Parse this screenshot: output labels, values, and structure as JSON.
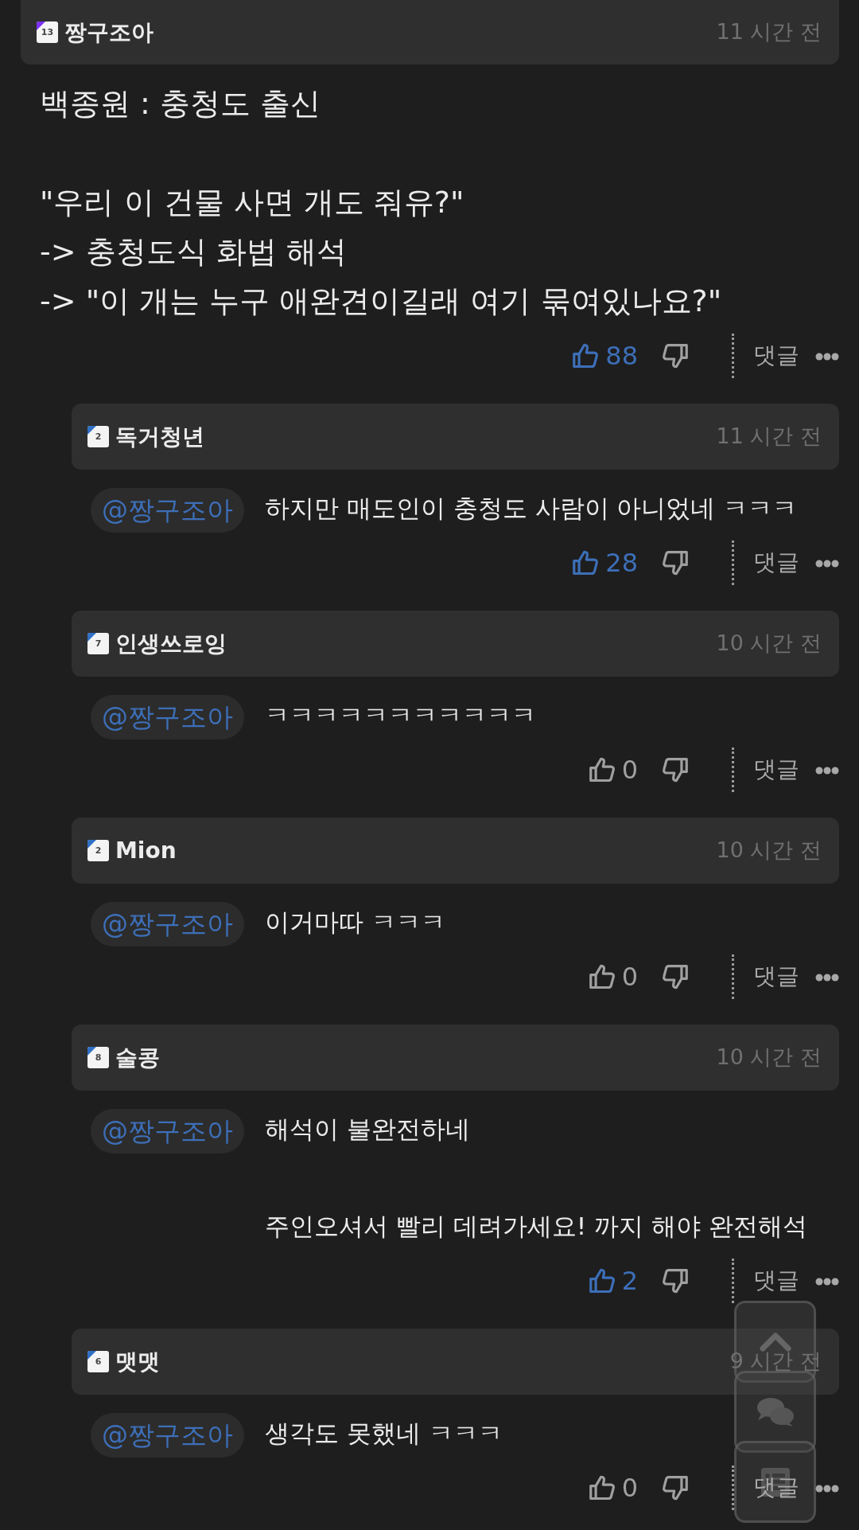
{
  "comments": [
    {
      "author": "짱구조아",
      "level": "13",
      "color": "#7b2ff7",
      "time": "11 시간 전",
      "text": "백종원 : 충청도 출신\n\n\"우리 이 건물 사면 개도 줘유?\"\n-> 충청도식 화법 해석\n-> \"이 개는 누구 애완견이길래 여기 묶여있나요?\"",
      "liked": true,
      "likes": "88",
      "reply_label": "댓글",
      "children": [
        {
          "author": "독거청년",
          "level": "2",
          "color": "#2f6fc4",
          "time": "11 시간 전",
          "mention": "@짱구조아",
          "text": "하지만 매도인이 충청도 사람이 아니었네 ㅋㅋㅋ",
          "liked": true,
          "likes": "28",
          "reply_label": "댓글"
        },
        {
          "author": "인생쓰로잉",
          "level": "7",
          "color": "#2f6fc4",
          "time": "10 시간 전",
          "mention": "@짱구조아",
          "text": "ㅋㅋㅋㅋㅋㅋㅋㅋㅋㅋㅋ",
          "liked": false,
          "likes": "0",
          "reply_label": "댓글"
        },
        {
          "author": "Mion",
          "level": "2",
          "color": "#2f6fc4",
          "time": "10 시간 전",
          "mention": "@짱구조아",
          "text": "이거마따 ㅋㅋㅋ",
          "liked": false,
          "likes": "0",
          "reply_label": "댓글"
        },
        {
          "author": "술콩",
          "level": "8",
          "color": "#2f6fc4",
          "time": "10 시간 전",
          "mention": "@짱구조아",
          "text": "해석이 불완전하네\n\n주인오셔서 빨리 데려가세요! 까지 해야 완전해석",
          "liked": true,
          "likes": "2",
          "reply_label": "댓글"
        },
        {
          "author": "맷맷",
          "level": "6",
          "color": "#2f6fc4",
          "time": "9 시간 전",
          "mention": "@짱구조아",
          "text": "생각도 못했네 ㅋㅋㅋ",
          "liked": false,
          "likes": "0",
          "reply_label": "댓글"
        }
      ]
    }
  ]
}
